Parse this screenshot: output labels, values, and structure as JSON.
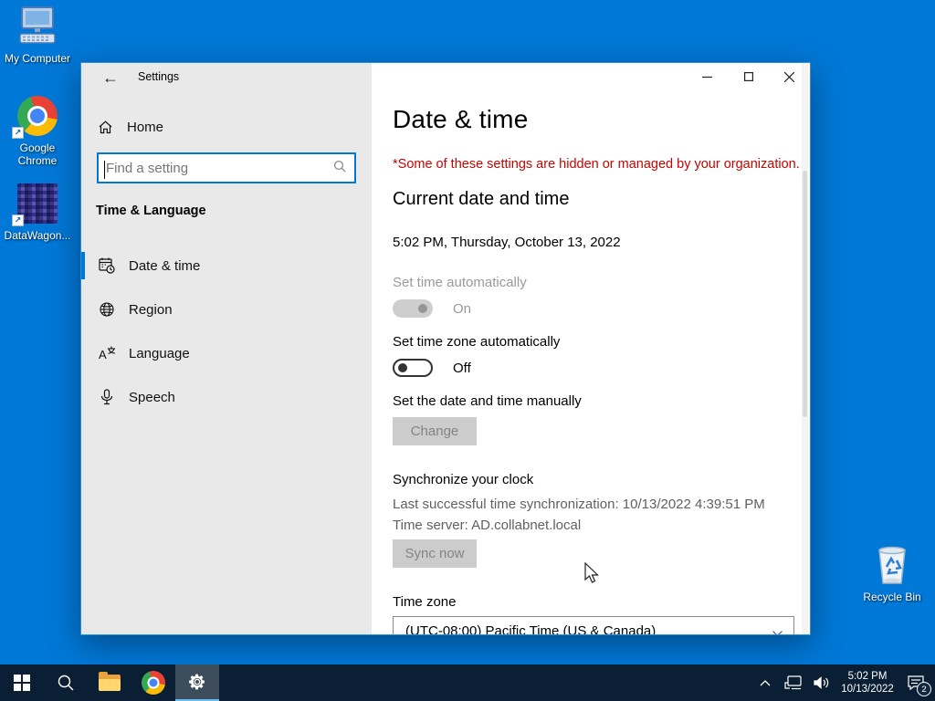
{
  "desktop": {
    "icons": [
      {
        "label": "My Computer"
      },
      {
        "label": "Google Chrome"
      },
      {
        "label": "DataWagon..."
      },
      {
        "label": "Recycle Bin"
      }
    ]
  },
  "window": {
    "title": "Settings",
    "controls": {
      "minimize": "minimize",
      "maximize": "maximize",
      "close": "close"
    },
    "nav": {
      "back_glyph": "←",
      "home_label": "Home",
      "search_placeholder": "Find a setting",
      "section_label": "Time & Language",
      "items": [
        {
          "label": "Date & time",
          "selected": true
        },
        {
          "label": "Region",
          "selected": false
        },
        {
          "label": "Language",
          "selected": false
        },
        {
          "label": "Speech",
          "selected": false
        }
      ]
    },
    "main": {
      "title": "Date & time",
      "org_notice": "*Some of these settings are hidden or managed by your organization.",
      "current_heading": "Current date and time",
      "current_value": "5:02 PM, Thursday, October 13, 2022",
      "set_time_label": "Set time automatically",
      "set_time_state": "On",
      "set_zone_label": "Set time zone automatically",
      "set_zone_state": "Off",
      "manual_label": "Set the date and time manually",
      "change_button": "Change",
      "sync_heading": "Synchronize your clock",
      "last_sync": "Last successful time synchronization: 10/13/2022 4:39:51 PM",
      "time_server": "Time server: AD.collabnet.local",
      "sync_button": "Sync now",
      "timezone_label": "Time zone",
      "timezone_value": "(UTC-08:00) Pacific Time (US & Canada)"
    }
  },
  "taskbar": {
    "tray": {
      "time": "5:02 PM",
      "date": "10/13/2022",
      "notification_badge": "2"
    }
  },
  "icons": {
    "back": "arrow-left",
    "home": "house",
    "search": "magnifier",
    "date_time": "calendar-clock",
    "region": "globe",
    "language": "a-character",
    "speech": "microphone",
    "start": "windows-logo",
    "file_explorer": "folder",
    "chrome": "chrome-ball",
    "settings_gear": "gear",
    "tray_chevron": "chevron-up",
    "network": "ethernet-monitor",
    "volume": "speaker",
    "action_center": "notification-bubble",
    "recycle_bin": "trash-bin"
  },
  "colors": {
    "desktop": "#0078d7",
    "accent": "#0078d7",
    "warning_red": "#c50500",
    "taskbar": "#0a1f33",
    "sidebar": "#e9e9e9",
    "disabled_button": "#cccccc"
  }
}
